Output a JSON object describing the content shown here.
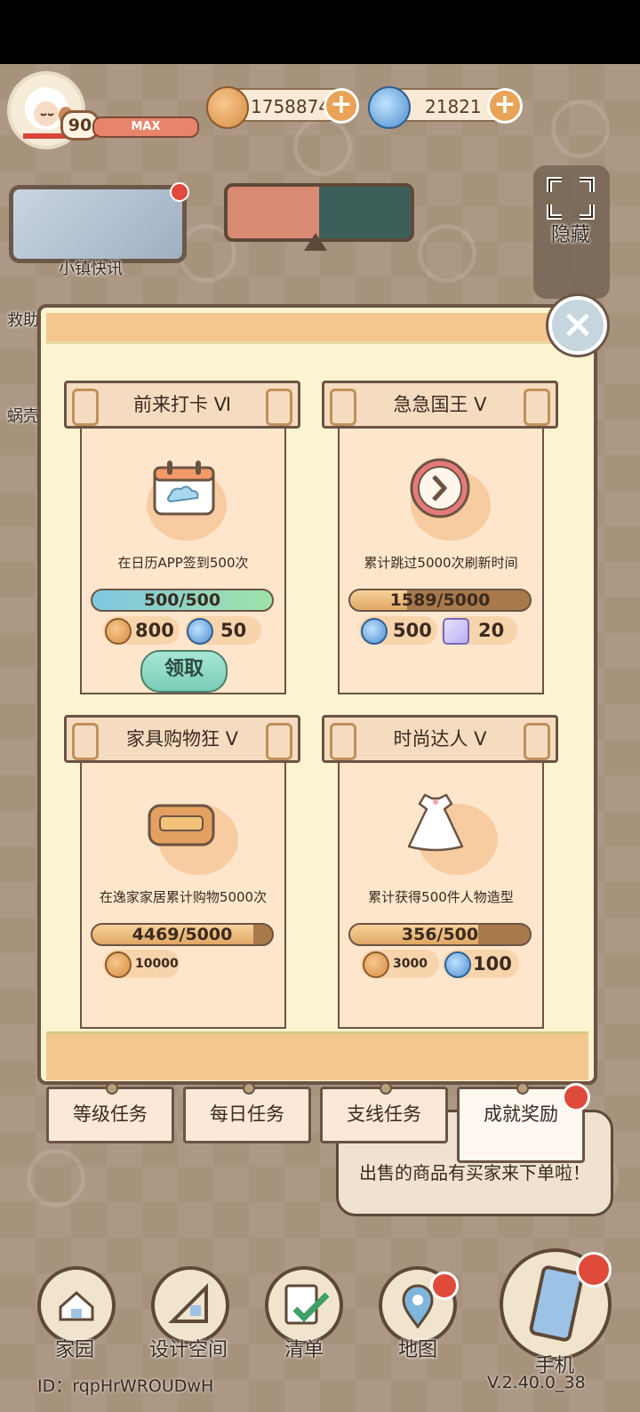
{
  "top_bar": {
    "level": "90",
    "level_status": "MAX",
    "coins": "1758874",
    "gems": "21821"
  },
  "widgets": {
    "news_label": "小镇快讯",
    "hide_label": "隐藏",
    "side_label_1": "救助",
    "side_label_2": "蜗壳"
  },
  "achievements": [
    {
      "title": "前来打卡 Ⅵ",
      "desc": "在日历APP签到500次",
      "progress": "500/500",
      "fraction": 1.0,
      "rewards": [
        {
          "icon": "coin-icon",
          "value": "800"
        },
        {
          "icon": "swirl-gem-icon",
          "value": "50"
        }
      ],
      "claim_label": "领取",
      "icon": "calendar-icon"
    },
    {
      "title": "急急国王 Ⅴ",
      "desc": "累计跳过5000次刷新时间",
      "progress": "1589/5000",
      "fraction": 0.318,
      "rewards": [
        {
          "icon": "swirl-gem-icon",
          "value": "500"
        },
        {
          "icon": "ticket-icon",
          "value": "20"
        }
      ],
      "icon": "clock-skip-icon"
    },
    {
      "title": "家具购物狂 Ⅴ",
      "desc": "在逸家家居累计购物5000次",
      "progress": "4469/5000",
      "fraction": 0.894,
      "rewards": [
        {
          "icon": "coin-icon",
          "value": "10000"
        }
      ],
      "icon": "sofa-icon"
    },
    {
      "title": "时尚达人 Ⅴ",
      "desc": "累计获得500件人物造型",
      "progress": "356/500",
      "fraction": 0.712,
      "rewards": [
        {
          "icon": "coin-icon",
          "value": "3000"
        },
        {
          "icon": "swirl-gem-icon",
          "value": "100"
        }
      ],
      "icon": "dress-icon"
    }
  ],
  "tabs": [
    "等级任务",
    "每日任务",
    "支线任务",
    "成就奖励"
  ],
  "active_tab": "成就奖励",
  "notification": "出售的商品有买家来下单啦！",
  "nav": [
    "家园",
    "设计空间",
    "清单",
    "地图",
    "手机"
  ],
  "footer": {
    "id": "ID：rqpHrWROUDwH",
    "version": "V.2.40.0_38"
  },
  "colors": {
    "panel": "#fcf4d0",
    "card": "#fde6cc",
    "border": "#6b5444",
    "accent_red": "#e04a3a"
  }
}
